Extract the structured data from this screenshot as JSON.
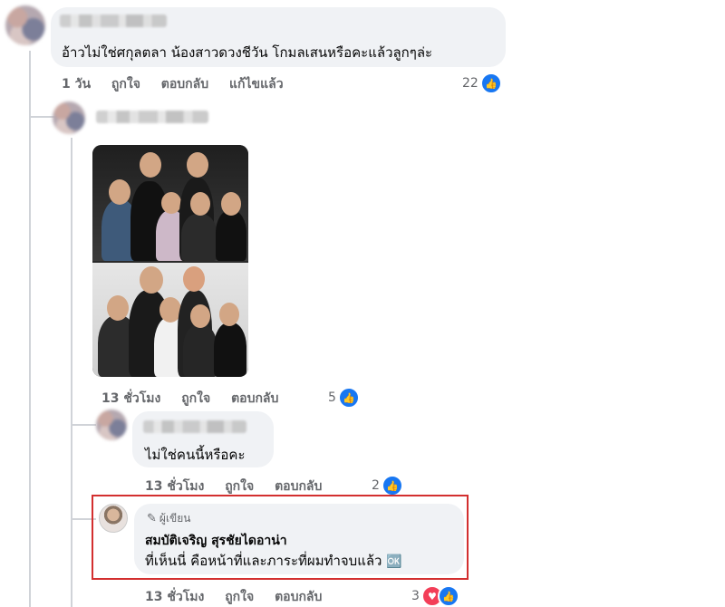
{
  "comments": [
    {
      "name": "",
      "text": "อ้าวไม่ใช่ศกุลตลา น้องสาวดวงชีวัน โกมลเสนหรือคะแล้วลูกๆล่ะ",
      "meta": {
        "time": "1 วัน",
        "like": "ถูกใจ",
        "reply": "ตอบกลับ",
        "edited": "แก้ไขแล้ว"
      },
      "reaction_count": "22"
    },
    {
      "name": "",
      "meta": {
        "time": "13 ชั่วโมง",
        "like": "ถูกใจ",
        "reply": "ตอบกลับ"
      },
      "reaction_count": "5"
    },
    {
      "name": "",
      "text": "ไม่ใช่คนนี้หรือคะ",
      "meta": {
        "time": "13 ชั่วโมง",
        "like": "ถูกใจ",
        "reply": "ตอบกลับ"
      },
      "reaction_count": "2"
    },
    {
      "badge": "ผู้เขียน",
      "name": "สมบัติเจริญ สุรชัยไดอาน่า",
      "text": "ที่เห็นนี่ คือหน้าที่และภาระที่ผมทำจบแล้ว",
      "emoji": "🆗",
      "meta": {
        "time": "13 ชั่วโมง",
        "like": "ถูกใจ",
        "reply": "ตอบกลับ"
      },
      "reaction_count": "3"
    }
  ],
  "icons": {
    "like": "like-icon",
    "heart": "heart-icon",
    "pencil": "pencil-icon"
  },
  "colors": {
    "highlight_border": "#d32f2f",
    "like_blue": "#1877f2",
    "heart_red": "#f33e58"
  }
}
